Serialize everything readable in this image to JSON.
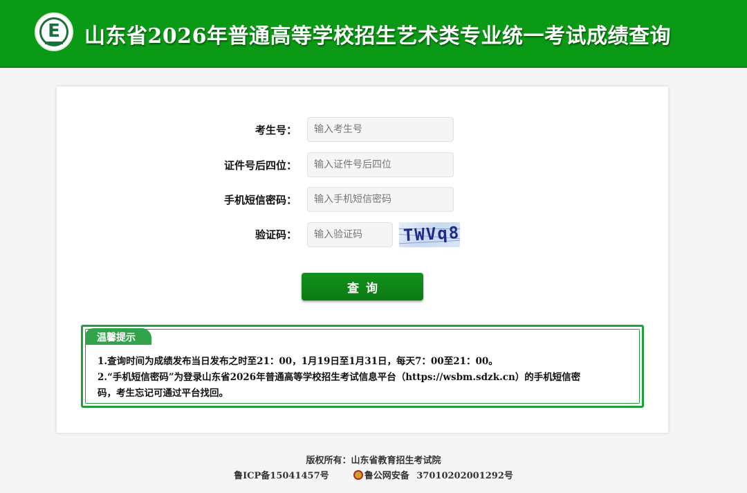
{
  "header": {
    "title": "山东省2026年普通高等学校招生艺术类专业统一考试成绩查询",
    "logo_letter": "E",
    "logo_icon": "exam-authority-logo-icon",
    "background_color": "#0a9a15"
  },
  "form": {
    "fields": [
      {
        "label": "考生号：",
        "placeholder": "输入考生号"
      },
      {
        "label": "证件号后四位：",
        "placeholder": "输入证件号后四位"
      },
      {
        "label": "手机短信密码：",
        "placeholder": "输入手机短信密码"
      },
      {
        "label": "验证码：",
        "placeholder": "输入验证码"
      }
    ],
    "captcha_text": "TWVq8",
    "submit_label": "查询",
    "button_color": "#0f8a19"
  },
  "notice": {
    "title": "温馨提示",
    "lines": [
      "1.查询时间为成绩发布当日发布之时至21：00，1月19日至1月31日，每天7：00至21：00。",
      "2.“手机短信密码”为登录山东省2026年普通高等学校招生考试信息平台（https://wsbm.sdzk.cn）的手机短信密",
      "码，考生忘记可通过平台找回。"
    ],
    "border_color": "#1f9e3a"
  },
  "footer": {
    "copyright": "版权所有：山东省教育招生考试院",
    "icp": "鲁ICP备15041457号",
    "police_label": "鲁公网安备",
    "police_number": "37010202001292号",
    "police_icon": "police-badge-icon"
  }
}
